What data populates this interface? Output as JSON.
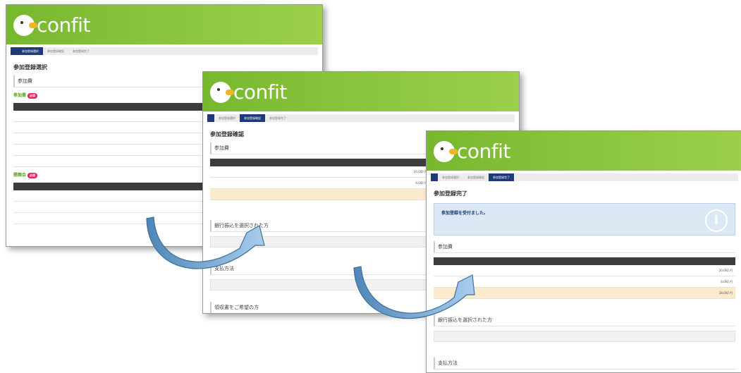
{
  "brand": {
    "logo_text": "confit",
    "logo_colors": {
      "header": "#8cc63f",
      "mark": "#ffffff",
      "beak": "#f0b428"
    }
  },
  "screen1": {
    "crumbs": [
      "参加登録選択",
      "参加登録確認",
      "参加登録完了"
    ],
    "page_title": "参加登録選択",
    "section": "参加費",
    "group1": "参加費",
    "group2": "懇親会",
    "badge": "必須"
  },
  "screen2": {
    "crumbs": [
      "参加登録選択",
      "参加登録確認",
      "参加登録完了"
    ],
    "page_title": "参加登録確認",
    "section1": "参加費",
    "section2": "銀行振込を選択された方",
    "section3": "支払方法",
    "section4": "領収書をご希望の方",
    "amount1": "20,000 円",
    "amount2": "8,000 円"
  },
  "screen3": {
    "crumbs": [
      "参加登録選択",
      "参加登録確認",
      "参加登録完了"
    ],
    "page_title": "参加登録完了",
    "info_text": "参加登録を受付ました。",
    "section1": "参加費",
    "section2": "銀行振込を選択された方",
    "section3": "支払方法",
    "amount1": "20,000 円",
    "amount2": "8,000 円",
    "amount3": "28,000 円"
  },
  "arrow_color": "#6fa3d0"
}
